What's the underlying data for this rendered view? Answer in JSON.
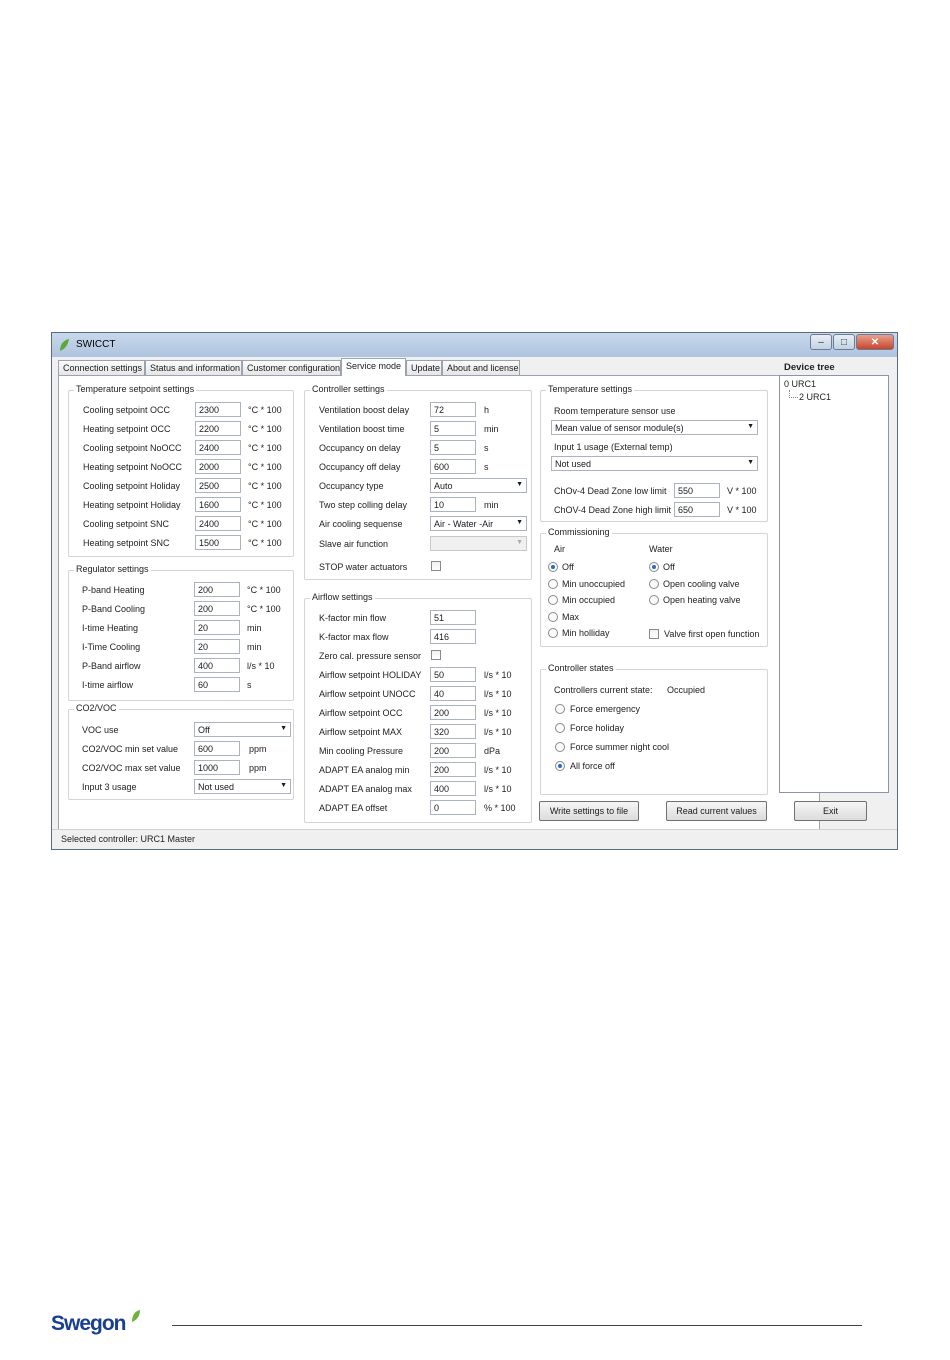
{
  "window": {
    "title": "SWICCT"
  },
  "tabs": [
    "Connection settings",
    "Status and information",
    "Customer configuration",
    "Service mode",
    "Update",
    "About and license"
  ],
  "temperature_setpoint_settings": {
    "title": "Temperature setpoint settings",
    "rows": [
      {
        "label": "Cooling setpoint OCC",
        "value": "2300",
        "unit": "°C * 100"
      },
      {
        "label": "Heating setpoint OCC",
        "value": "2200",
        "unit": "°C * 100"
      },
      {
        "label": "Cooling setpoint NoOCC",
        "value": "2400",
        "unit": "°C * 100"
      },
      {
        "label": "Heating setpoint NoOCC",
        "value": "2000",
        "unit": "°C * 100"
      },
      {
        "label": "Cooling setpoint Holiday",
        "value": "2500",
        "unit": "°C * 100"
      },
      {
        "label": "Heating setpoint Holiday",
        "value": "1600",
        "unit": "°C * 100"
      },
      {
        "label": "Cooling setpoint SNC",
        "value": "2400",
        "unit": "°C * 100"
      },
      {
        "label": "Heating setpoint SNC",
        "value": "1500",
        "unit": "°C * 100"
      }
    ]
  },
  "regulator_settings": {
    "title": "Regulator settings",
    "rows": [
      {
        "label": "P-band Heating",
        "value": "200",
        "unit": "°C * 100"
      },
      {
        "label": "P-Band Cooling",
        "value": "200",
        "unit": "°C * 100"
      },
      {
        "label": "I-time Heating",
        "value": "20",
        "unit": "min"
      },
      {
        "label": "I-Time Cooling",
        "value": "20",
        "unit": "min"
      },
      {
        "label": "P-Band airflow",
        "value": "400",
        "unit": "l/s * 10"
      },
      {
        "label": "I-time airflow",
        "value": "60",
        "unit": "s"
      }
    ]
  },
  "co2_voc": {
    "title": "CO2/VOC",
    "voc_use_label": "VOC use",
    "voc_use_value": "Off",
    "min_label": "CO2/VOC min set value",
    "min_value": "600",
    "min_unit": "ppm",
    "max_label": "CO2/VOC max set value",
    "max_value": "1000",
    "max_unit": "ppm",
    "input3_label": "Input 3 usage",
    "input3_value": "Not used"
  },
  "controller_settings": {
    "title": "Controller settings",
    "rows": [
      {
        "label": "Ventilation boost delay",
        "value": "72",
        "unit": "h"
      },
      {
        "label": "Ventilation boost time",
        "value": "5",
        "unit": "min"
      },
      {
        "label": "Occupancy on delay",
        "value": "5",
        "unit": "s"
      },
      {
        "label": "Occupancy off delay",
        "value": "600",
        "unit": "s"
      }
    ],
    "occupancy_type_label": "Occupancy type",
    "occupancy_type_value": "Auto",
    "two_step_label": "Two step colling delay",
    "two_step_value": "10",
    "two_step_unit": "min",
    "air_cooling_label": "Air cooling sequense",
    "air_cooling_value": "Air - Water -Air",
    "slave_air_label": "Slave air function",
    "slave_air_value": "",
    "stop_water_label": "STOP water actuators"
  },
  "airflow_settings": {
    "title": "Airflow settings",
    "rows_top": [
      {
        "label": "K-factor min flow",
        "value": "51"
      },
      {
        "label": "K-factor max flow",
        "value": "416"
      }
    ],
    "zero_cal_label": "Zero cal. pressure sensor",
    "rows": [
      {
        "label": "Airflow setpoint HOLIDAY",
        "value": "50",
        "unit": "l/s * 10"
      },
      {
        "label": "Airflow setpoint UNOCC",
        "value": "40",
        "unit": "l/s * 10"
      },
      {
        "label": "Airflow setpoint OCC",
        "value": "200",
        "unit": "l/s * 10"
      },
      {
        "label": "Airflow setpoint MAX",
        "value": "320",
        "unit": "l/s * 10"
      },
      {
        "label": "Min cooling Pressure",
        "value": "200",
        "unit": "dPa"
      },
      {
        "label": "ADAPT EA analog min",
        "value": "200",
        "unit": "l/s * 10"
      },
      {
        "label": "ADAPT EA analog max",
        "value": "400",
        "unit": "l/s * 10"
      },
      {
        "label": "ADAPT EA offset",
        "value": "0",
        "unit": "% * 100"
      }
    ]
  },
  "temperature_settings": {
    "title": "Temperature settings",
    "room_sensor_label": "Room temperature sensor use",
    "room_sensor_value": "Mean value of sensor module(s)",
    "input1_label": "Input 1 usage (External temp)",
    "input1_value": "Not used",
    "low_label": "ChOv-4 Dead Zone low limit",
    "low_value": "550",
    "low_unit": "V * 100",
    "high_label": "ChOV-4 Dead Zone high limit",
    "high_value": "650",
    "high_unit": "V * 100"
  },
  "commissioning": {
    "title": "Commissioning",
    "air_header": "Air",
    "water_header": "Water",
    "air_options": [
      "Off",
      "Min unoccupied",
      "Min occupied",
      "Max",
      "Min holliday"
    ],
    "water_options": [
      "Off",
      "Open cooling valve",
      "Open heating valve"
    ],
    "valve_first_label": "Valve first open function"
  },
  "controller_states": {
    "title": "Controller states",
    "current_label": "Controllers current state:",
    "current_value": "Occupied",
    "options": [
      "Force emergency",
      "Force holiday",
      "Force summer night cool",
      "All force off"
    ]
  },
  "buttons": {
    "write": "Write settings to file",
    "read": "Read current values",
    "exit": "Exit"
  },
  "device_tree": {
    "title": "Device tree",
    "root": "0 URC1",
    "child": "2 URC1"
  },
  "status_bar": "Selected controller: URC1 Master",
  "brand": {
    "logo_text": "Swegon",
    "logo_color": "#1b3f8f",
    "leaf_color": "#6cb33e"
  }
}
